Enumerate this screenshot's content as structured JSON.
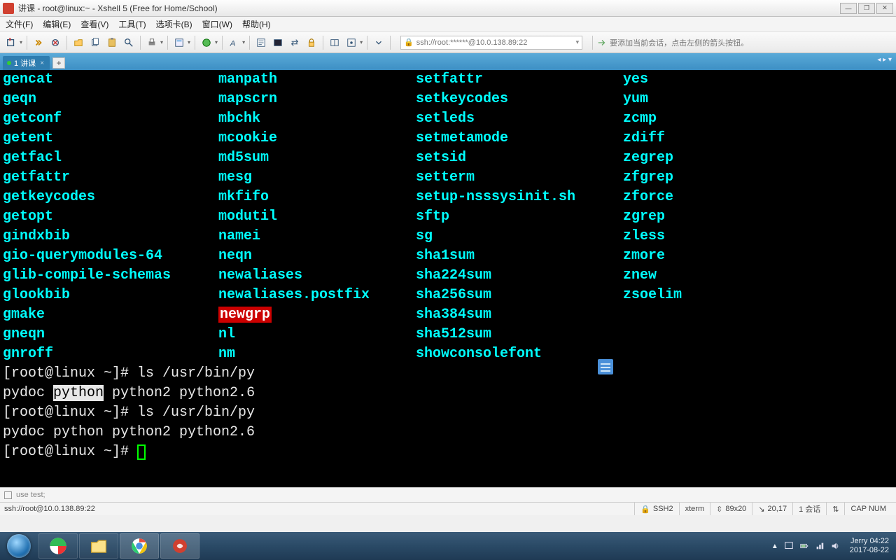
{
  "window": {
    "title": "讲课 - root@linux:~ - Xshell 5 (Free for Home/School)"
  },
  "menu": [
    "文件(F)",
    "编辑(E)",
    "查看(V)",
    "工具(T)",
    "选项卡(B)",
    "窗口(W)",
    "帮助(H)"
  ],
  "address": "ssh://root:******@10.0.138.89:22",
  "tip_text": "要添加当前会话，点击左侧的箭头按钮。",
  "tab": {
    "label": "1 讲课"
  },
  "term": {
    "col1": [
      "gencat",
      "geqn",
      "getconf",
      "getent",
      "getfacl",
      "getfattr",
      "getkeycodes",
      "getopt",
      "gindxbib",
      "gio-querymodules-64",
      "glib-compile-schemas",
      "glookbib",
      "gmake",
      "gneqn",
      "gnroff"
    ],
    "col2_pre": [
      "manpath",
      "mapscrn",
      "mbchk",
      "mcookie",
      "md5sum",
      "mesg",
      "mkfifo",
      "modutil",
      "namei",
      "neqn",
      "newaliases",
      "newaliases.postfix"
    ],
    "col2_hl": "newgrp",
    "col2_post": [
      "nl",
      "nm"
    ],
    "col3": [
      "setfattr",
      "setkeycodes",
      "setleds",
      "setmetamode",
      "setsid",
      "setterm",
      "setup-nsssysinit.sh",
      "sftp",
      "sg",
      "sha1sum",
      "sha224sum",
      "sha256sum",
      "sha384sum",
      "sha512sum",
      "showconsolefont"
    ],
    "col4": [
      "yes",
      "yum",
      "zcmp",
      "zdiff",
      "zegrep",
      "zfgrep",
      "zforce",
      "zgrep",
      "zless",
      "zmore",
      "znew",
      "zsoelim"
    ],
    "prompt1": "[root@linux ~]# ls /usr/bin/py",
    "row1": {
      "a": "pydoc",
      "b": "python",
      "c": "python2",
      "d": "python2.6"
    },
    "prompt2": "[root@linux ~]# ls /usr/bin/py",
    "row2": {
      "a": "pydoc",
      "b": "python",
      "c": "python2",
      "d": "python2.6"
    },
    "prompt3": "[root@linux ~]# "
  },
  "inputbar_text": "use test;",
  "status": {
    "left": "ssh://root@10.0.138.89:22",
    "ssh": "SSH2",
    "term": "xterm",
    "size": "89x20",
    "pos": "20,17",
    "sessions": "1 会话",
    "caps": "CAP  NUM"
  },
  "tray": {
    "user_time": "Jerry 04:22",
    "date": "2017-08-22"
  }
}
